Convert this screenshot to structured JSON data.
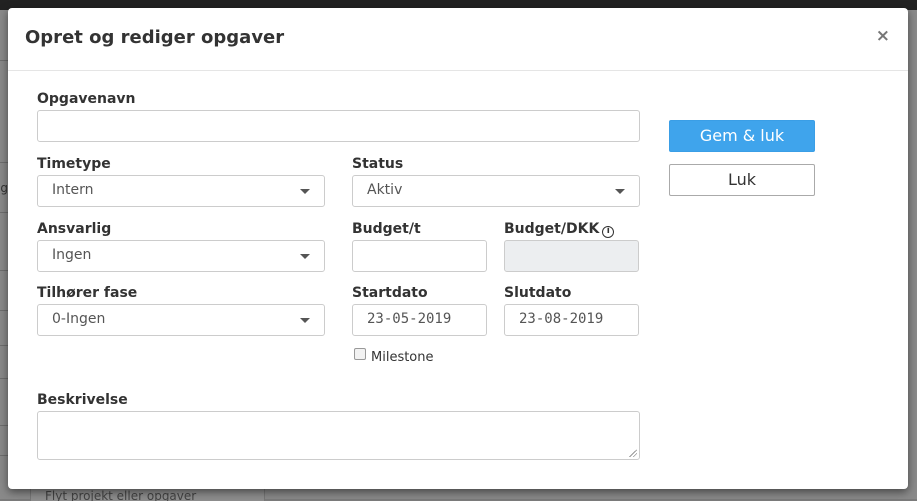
{
  "background": {
    "fragment_text": "g",
    "bottom_text": "Flyt projekt eller opgaver"
  },
  "modal": {
    "title": "Opret og rediger opgaver",
    "close_label": "×"
  },
  "form": {
    "task_name": {
      "label": "Opgavenavn",
      "value": ""
    },
    "time_type": {
      "label": "Timetype",
      "value": "Intern"
    },
    "status": {
      "label": "Status",
      "value": "Aktiv"
    },
    "responsible": {
      "label": "Ansvarlig",
      "value": "Ingen"
    },
    "budget_hours": {
      "label": "Budget/t",
      "value": ""
    },
    "budget_dkk": {
      "label": "Budget/DKK",
      "value": "",
      "info_icon": "i"
    },
    "phase": {
      "label": "Tilhører fase",
      "value": "0-Ingen"
    },
    "start_date": {
      "label": "Startdato",
      "value": "23-05-2019"
    },
    "end_date": {
      "label": "Slutdato",
      "value": "23-08-2019"
    },
    "milestone": {
      "label": "Milestone",
      "checked": false
    },
    "description": {
      "label": "Beskrivelse",
      "value": ""
    }
  },
  "buttons": {
    "save_close": "Gem & luk",
    "close": "Luk"
  },
  "colors": {
    "primary": "#3fa4ec",
    "disabled_field": "#eceef0",
    "overlay": "#7b7b7b"
  }
}
